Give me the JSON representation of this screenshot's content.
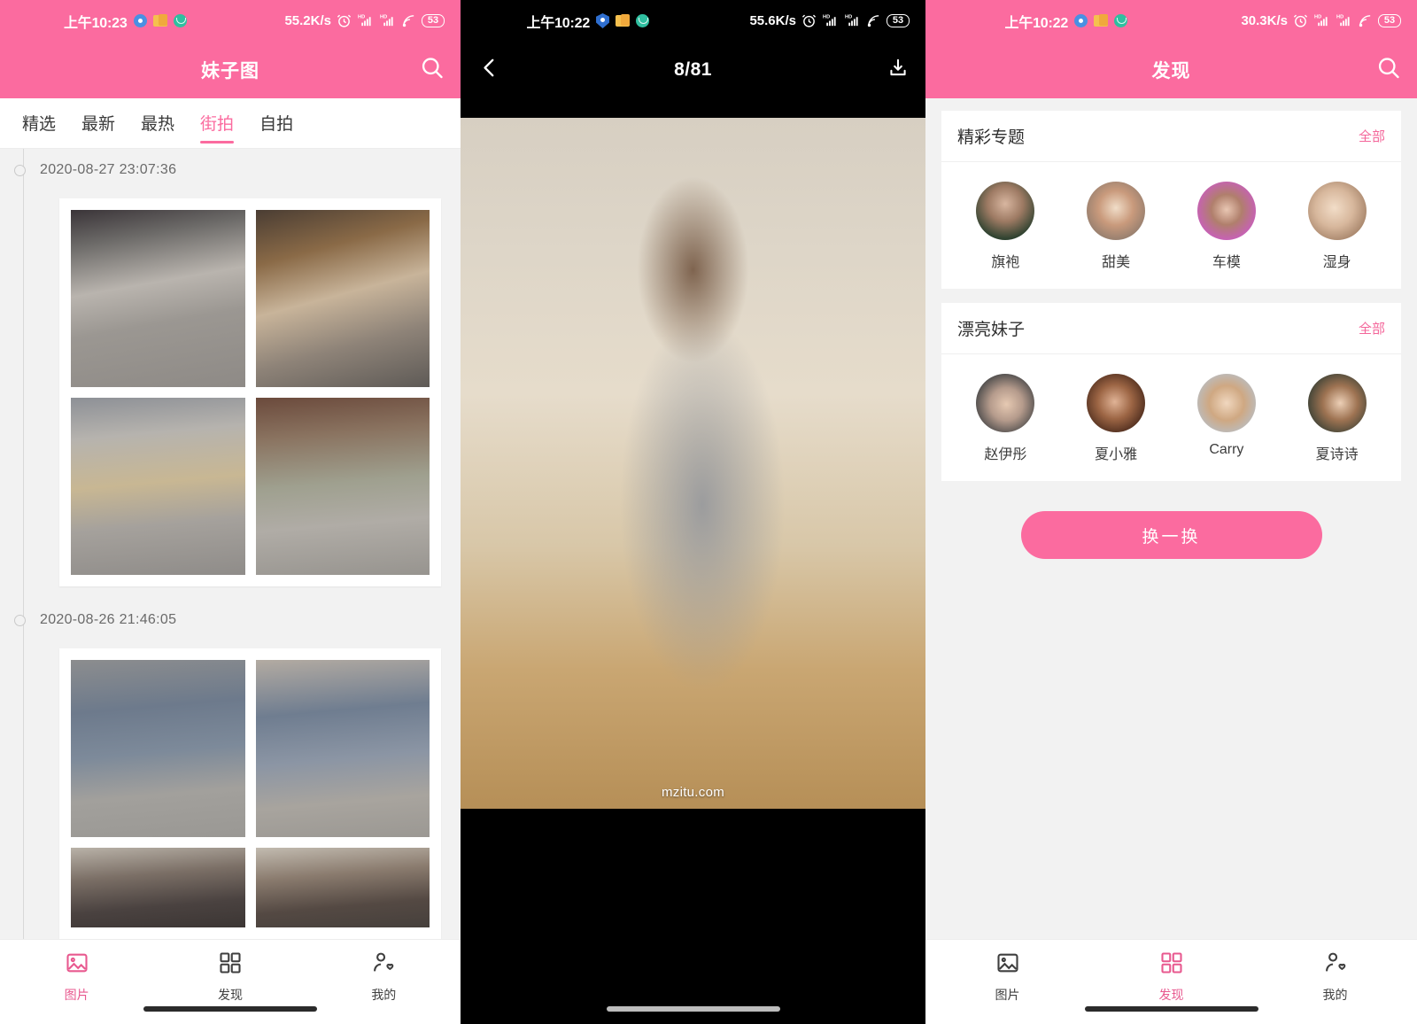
{
  "panels": {
    "gallery": {
      "status": {
        "time": "上午10:23",
        "speed": "55.2K/s",
        "battery": "53",
        "net_badge": "HD"
      },
      "appbar": {
        "title": "妹子图",
        "search_icon": "search-icon"
      },
      "tabs": [
        {
          "label": "精选",
          "active": false
        },
        {
          "label": "最新",
          "active": false
        },
        {
          "label": "最热",
          "active": false
        },
        {
          "label": "街拍",
          "active": true
        },
        {
          "label": "自拍",
          "active": false
        }
      ],
      "groups": [
        {
          "date": "2020-08-27 23:07:36",
          "thumbs": [
            "street-white-skirt-back",
            "street-white-skirt-shop",
            "street-white-skirt-bag",
            "street-white-skirt-plaza"
          ]
        },
        {
          "date": "2020-08-26 21:46:05",
          "thumbs": [
            "street-blue-dress-back",
            "street-blue-dress-crowd",
            "street-long-hair-crowd",
            "street-long-hair-bag"
          ]
        }
      ],
      "bottom_nav": [
        {
          "label": "图片",
          "icon": "image-icon",
          "active": true
        },
        {
          "label": "发现",
          "icon": "grid-icon",
          "active": false
        },
        {
          "label": "我的",
          "icon": "user-heart-icon",
          "active": false
        }
      ]
    },
    "viewer": {
      "status": {
        "time": "上午10:22",
        "speed": "55.6K/s",
        "battery": "53",
        "net_badge": "HD"
      },
      "back_icon": "chevron-left-icon",
      "counter": "8/81",
      "download_icon": "download-icon",
      "watermark": "mzitu.com",
      "photo_alt": "woman-grey-vest-skirt-gallery"
    },
    "discover": {
      "status": {
        "time": "上午10:22",
        "speed": "30.3K/s",
        "battery": "53",
        "net_badge": "HD"
      },
      "appbar": {
        "title": "发现",
        "search_icon": "search-icon"
      },
      "sections": [
        {
          "title": "精彩专题",
          "more": "全部",
          "items": [
            {
              "name": "旗袍"
            },
            {
              "name": "甜美"
            },
            {
              "name": "车模"
            },
            {
              "name": "湿身"
            }
          ]
        },
        {
          "title": "漂亮妹子",
          "more": "全部",
          "items": [
            {
              "name": "赵伊彤"
            },
            {
              "name": "夏小雅"
            },
            {
              "name": "Carry"
            },
            {
              "name": "夏诗诗"
            }
          ]
        }
      ],
      "refresh_button": "换一换",
      "bottom_nav": [
        {
          "label": "图片",
          "icon": "image-icon",
          "active": false
        },
        {
          "label": "发现",
          "icon": "grid-icon",
          "active": true
        },
        {
          "label": "我的",
          "icon": "user-heart-icon",
          "active": false
        }
      ]
    }
  },
  "colors": {
    "brand_pink": "#fb6b9f",
    "accent_pink": "#f4669a",
    "page_bg": "#f2f2f2",
    "viewer_bg": "#000000"
  }
}
